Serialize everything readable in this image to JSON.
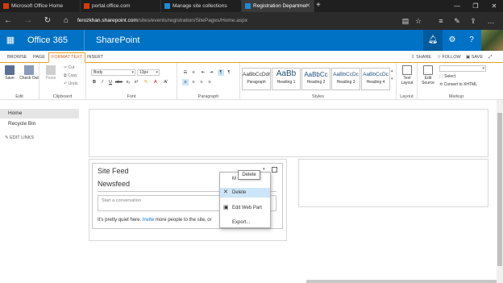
{
  "browser": {
    "tabs": [
      {
        "title": "Microsoft Office Home",
        "icon_color": "#d83b01"
      },
      {
        "title": "portal.office.com",
        "icon_color": "#d83b01"
      },
      {
        "title": "Manage site collections",
        "icon_color": "#1e8bd6"
      },
      {
        "title": "Registration Departmer",
        "icon_color": "#1e8bd6"
      }
    ],
    "new_tab": "+",
    "url_host": "ferozkhan.sharepoint.com",
    "url_path": "/sites/events/registration/SitePages/Home.aspx",
    "window_controls": [
      "—",
      "❐",
      "✕"
    ]
  },
  "suite": {
    "app_name": "Office 365",
    "site_name": "SharePoint",
    "notification_count": "1",
    "icons": [
      "bell-icon",
      "gear-icon",
      "help-icon"
    ]
  },
  "ribbon_tabs": [
    "BROWSE",
    "PAGE",
    "FORMAT TEXT",
    "INSERT"
  ],
  "ribbon_right": {
    "share": "SHARE",
    "follow": "FOLLOW",
    "save": "SAVE"
  },
  "ribbon": {
    "edit": {
      "save": "Save",
      "check_out": "Check Out",
      "label": "Edit"
    },
    "clipboard": {
      "paste": "Paste",
      "cut": "Cut",
      "copy": "Copy",
      "undo": "Undo",
      "label": "Clipboard"
    },
    "font": {
      "family": "Body",
      "size": "13px",
      "label": "Font"
    },
    "paragraph": {
      "label": "Paragraph"
    },
    "styles": {
      "items": [
        {
          "preview": "AaBbCcDdI",
          "name": "Paragraph"
        },
        {
          "preview": "AaBb",
          "name": "Heading 1"
        },
        {
          "preview": "AaBbCc",
          "name": "Heading 2"
        },
        {
          "preview": "AaBbCcDc",
          "name": "Heading 3"
        },
        {
          "preview": "AaBbCcDc",
          "name": "Heading 4"
        }
      ],
      "label": "Styles"
    },
    "layout": {
      "text_layout": "Text Layout",
      "label": "Layout"
    },
    "markup": {
      "edit_source": "Edit Source",
      "select": "Select",
      "convert": "Convert to XHTML",
      "label": "Markup"
    }
  },
  "leftnav": {
    "items": [
      "Home",
      "Recycle Bin"
    ],
    "edit_links": "EDIT LINKS"
  },
  "webpart": {
    "title": "Site Feed",
    "newsfeed": "Newsfeed",
    "placeholder": "Start a conversation",
    "quiet_prefix": "It's pretty quiet here.",
    "invite": "Invite",
    "quiet_suffix": "more people to the site, or"
  },
  "menu": {
    "tooltip": "Delete",
    "partial": "M",
    "items": [
      "Delete",
      "Edit Web Part",
      "Export..."
    ]
  }
}
